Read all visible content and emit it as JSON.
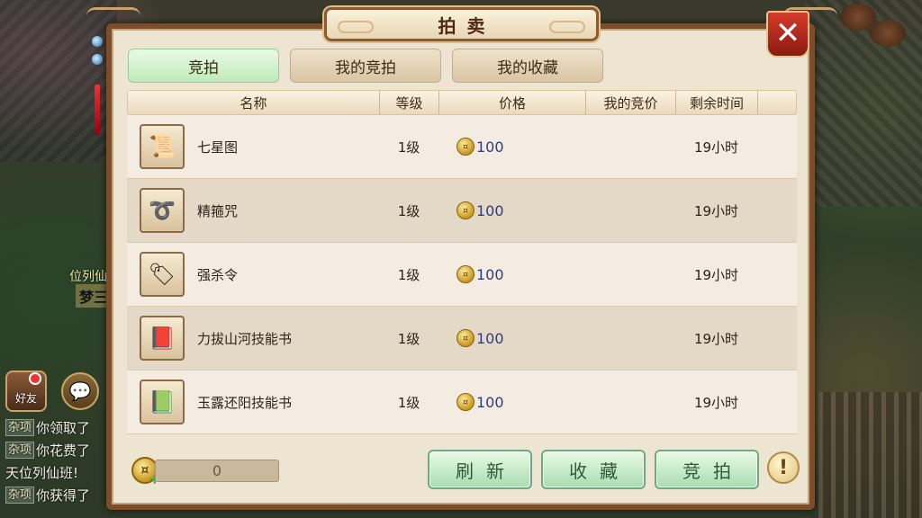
{
  "panel": {
    "title": "拍卖"
  },
  "tabs": [
    {
      "label": "竞拍",
      "active": true
    },
    {
      "label": "我的竞拍",
      "active": false
    },
    {
      "label": "我的收藏",
      "active": false
    }
  ],
  "table": {
    "headers": {
      "name": "名称",
      "level": "等级",
      "price": "价格",
      "my_bid": "我的竞价",
      "time_left": "剩余时间"
    },
    "rows": [
      {
        "icon": "map-scroll-icon",
        "name": "七星图",
        "level": "1级",
        "price": "100",
        "my_bid": "",
        "time_left": "19小时"
      },
      {
        "icon": "golden-ring-icon",
        "name": "精箍咒",
        "level": "1级",
        "price": "100",
        "my_bid": "",
        "time_left": "19小时"
      },
      {
        "icon": "decree-token-icon",
        "name": "强杀令",
        "level": "1级",
        "price": "100",
        "my_bid": "",
        "time_left": "19小时"
      },
      {
        "icon": "brown-skill-book-icon",
        "name": "力拔山河技能书",
        "level": "1级",
        "price": "100",
        "my_bid": "",
        "time_left": "19小时"
      },
      {
        "icon": "green-skill-book-icon",
        "name": "玉露还阳技能书",
        "level": "1级",
        "price": "100",
        "my_bid": "",
        "time_left": "19小时"
      }
    ]
  },
  "footer": {
    "balance": "0",
    "buttons": {
      "refresh": "刷新",
      "favorite": "收藏",
      "bid": "竞拍"
    },
    "info_symbol": "!"
  },
  "hud": {
    "side_title": "位列仙",
    "watermark": "梦三年源码",
    "friend_label": "好友",
    "chat_lines": [
      {
        "tag": "杂项",
        "text": "你领取了"
      },
      {
        "tag": "杂项",
        "text": "你花费了"
      },
      {
        "tag": "",
        "text": "天位列仙班!"
      },
      {
        "tag": "杂项",
        "text": "你获得了"
      }
    ]
  },
  "colors": {
    "accent_green": "#bfeaba",
    "close_red": "#d63a2a",
    "price_blue": "#2e3a8a",
    "panel_frame": "#7a4d2c"
  }
}
